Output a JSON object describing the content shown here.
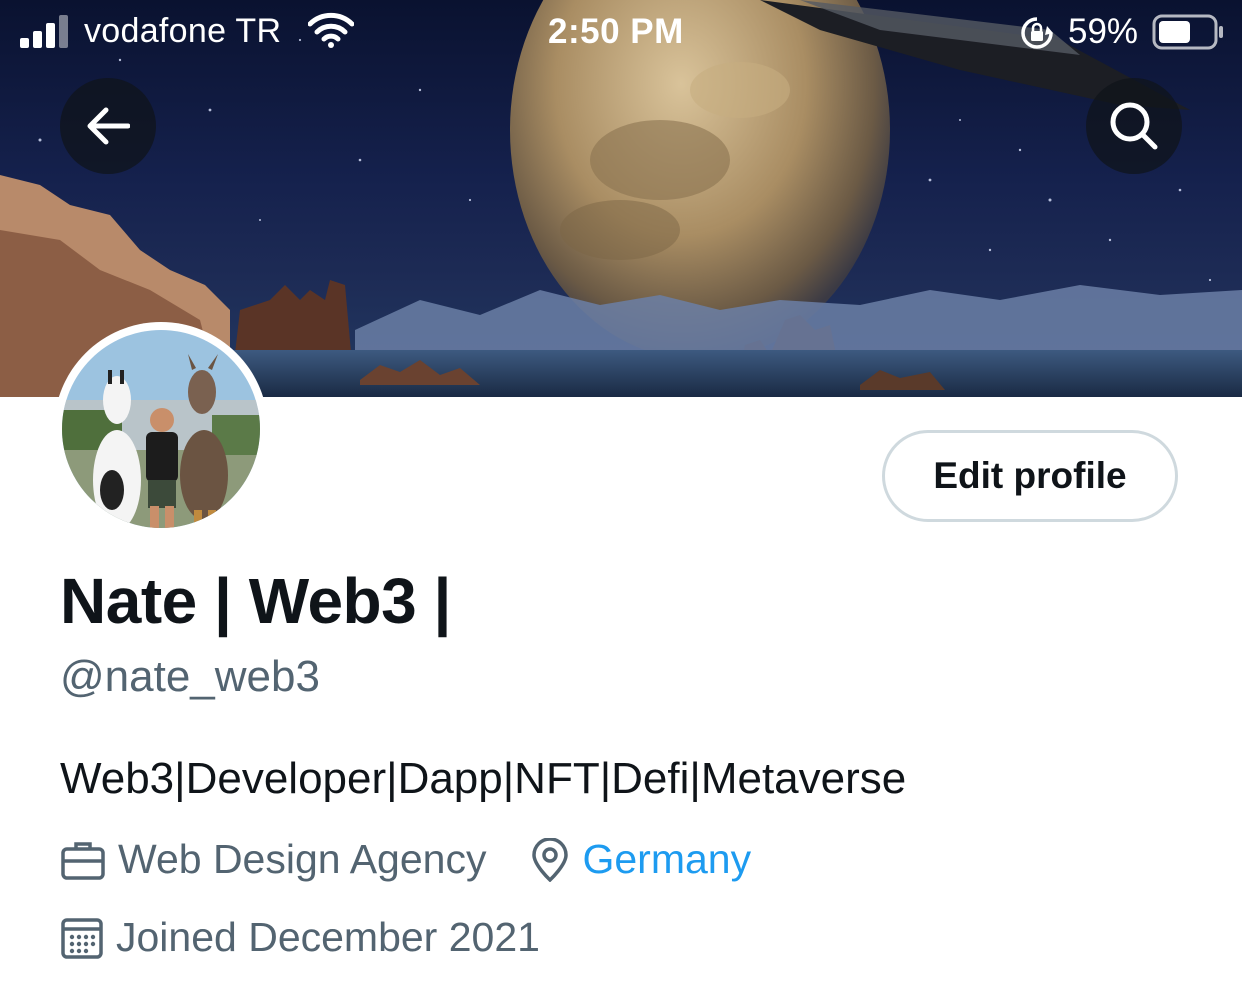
{
  "status_bar": {
    "carrier": "vodafone TR",
    "time": "2:50 PM",
    "battery_percent": "59%",
    "battery_level": 0.59,
    "icons": [
      "signal-bars-icon",
      "wifi-icon",
      "rotation-lock-icon",
      "battery-icon"
    ]
  },
  "header": {
    "back_icon": "arrow-left-icon",
    "search_icon": "search-icon"
  },
  "profile": {
    "display_name": "Nate | Web3 |",
    "handle": "@nate_web3",
    "bio": "Web3|Developer|Dapp|NFT|Defi|Metaverse",
    "category": "Web Design Agency",
    "location": "Germany",
    "joined": "Joined December 2021",
    "edit_button_label": "Edit profile"
  },
  "colors": {
    "text_primary": "#0f1419",
    "text_secondary": "#536471",
    "link": "#1d9bf0",
    "button_border": "#cfd9de"
  }
}
